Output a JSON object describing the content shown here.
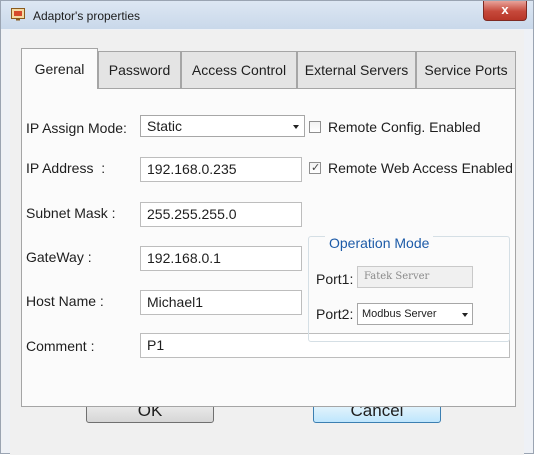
{
  "window": {
    "title": "Adaptor's properties",
    "close_glyph": "x"
  },
  "tabs": [
    {
      "label": "Gerenal",
      "active": true
    },
    {
      "label": "Password",
      "active": false
    },
    {
      "label": "Access Control",
      "active": false
    },
    {
      "label": "External Servers",
      "active": false
    },
    {
      "label": "Service Ports",
      "active": false
    }
  ],
  "general": {
    "ip_assign_mode": {
      "label": "IP Assign Mode:",
      "value": "Static"
    },
    "remote_config": {
      "label": "Remote Config. Enabled",
      "checked": false
    },
    "ip_address": {
      "label": "IP Address  :",
      "value": "192.168.0.235"
    },
    "remote_web_access": {
      "label": "Remote Web Access Enabled",
      "checked": true
    },
    "subnet_mask": {
      "label": "Subnet Mask :",
      "value": "255.255.255.0"
    },
    "gateway": {
      "label": "GateWay :",
      "value": "192.168.0.1"
    },
    "host_name": {
      "label": "Host Name :",
      "value": "Michael1"
    },
    "comment": {
      "label": "Comment :",
      "value": "P1"
    },
    "operation_mode": {
      "title": "Operation Mode",
      "port1": {
        "label": "Port1:",
        "value": "Fatek Server"
      },
      "port2": {
        "label": "Port2:",
        "value": "Modbus Server"
      }
    }
  },
  "buttons": {
    "ok": "OK",
    "cancel": "Cancel"
  },
  "colors": {
    "group_title": "#1d5ba8",
    "close_button": "#c6483a"
  },
  "icons": {
    "app": "adaptor-icon",
    "close": "close-icon",
    "dropdown": "chevron-down-icon",
    "check": "checkmark-icon"
  }
}
